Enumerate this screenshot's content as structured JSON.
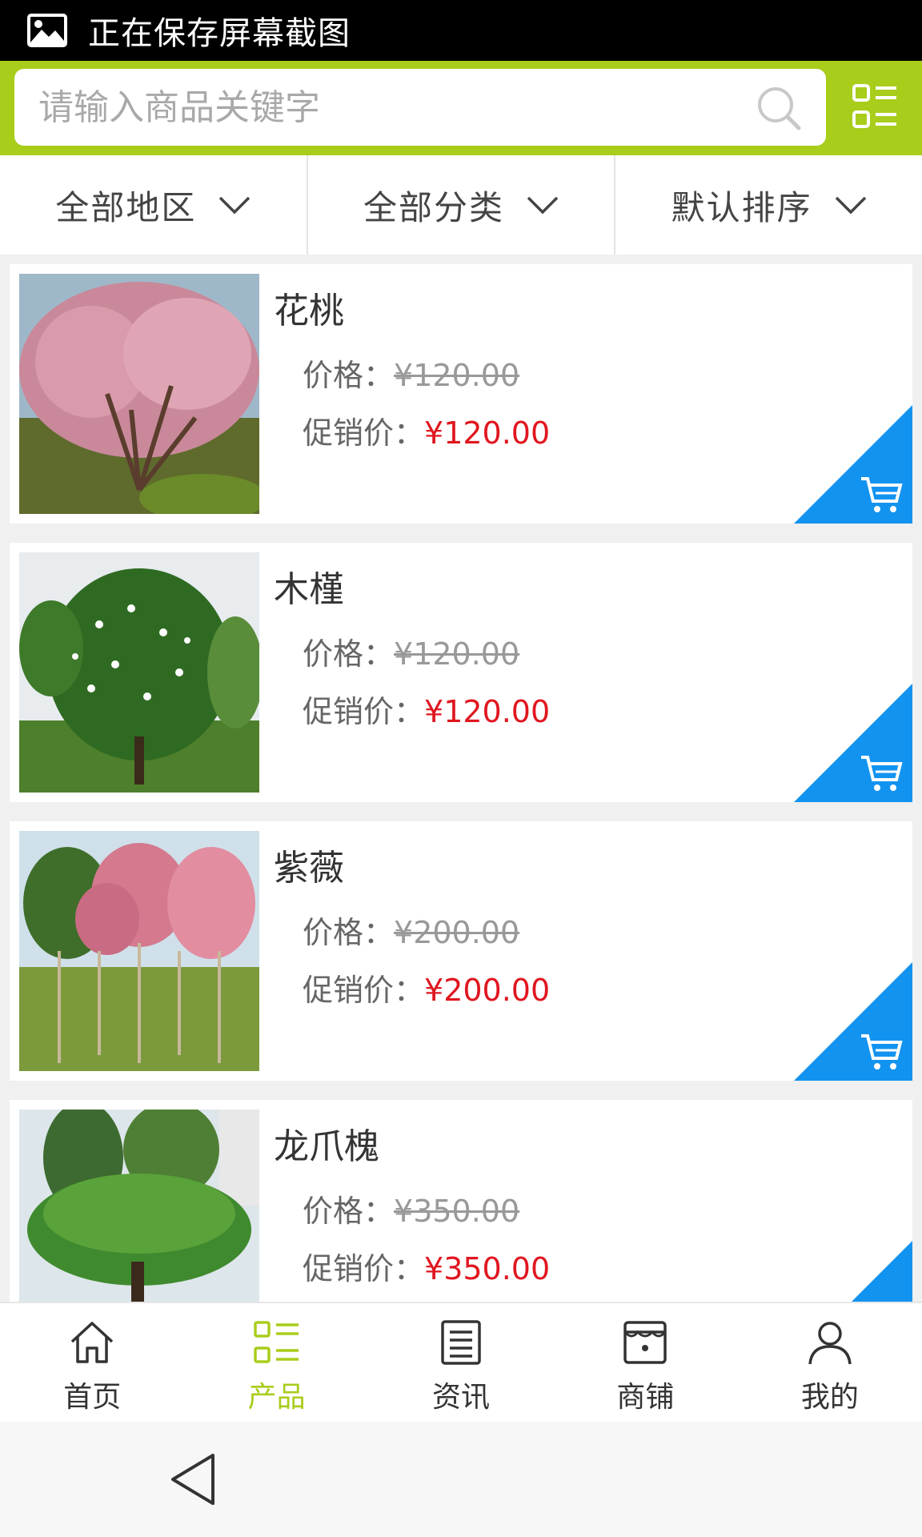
{
  "status_bar": {
    "text": "正在保存屏幕截图"
  },
  "search": {
    "placeholder": "请输入商品关键字"
  },
  "filters": [
    {
      "label": "全部地区"
    },
    {
      "label": "全部分类"
    },
    {
      "label": "默认排序"
    }
  ],
  "price_label": "价格：",
  "promo_label": "促销价：",
  "products": [
    {
      "name": "花桃",
      "price": "¥120.00",
      "promo_price": "¥120.00"
    },
    {
      "name": "木槿",
      "price": "¥120.00",
      "promo_price": "¥120.00"
    },
    {
      "name": "紫薇",
      "price": "¥200.00",
      "promo_price": "¥200.00"
    },
    {
      "name": "龙爪槐",
      "price": "¥350.00",
      "promo_price": "¥350.00"
    }
  ],
  "tabs": [
    {
      "label": "首页",
      "icon": "home-icon"
    },
    {
      "label": "产品",
      "icon": "grid-list-icon",
      "active": true
    },
    {
      "label": "资讯",
      "icon": "news-icon"
    },
    {
      "label": "商铺",
      "icon": "store-icon"
    },
    {
      "label": "我的",
      "icon": "user-icon"
    }
  ],
  "colors": {
    "brand_green": "#a8cd1b",
    "cart_blue": "#1393f0",
    "promo_red": "#e0161f",
    "status_bar": "#000000"
  }
}
